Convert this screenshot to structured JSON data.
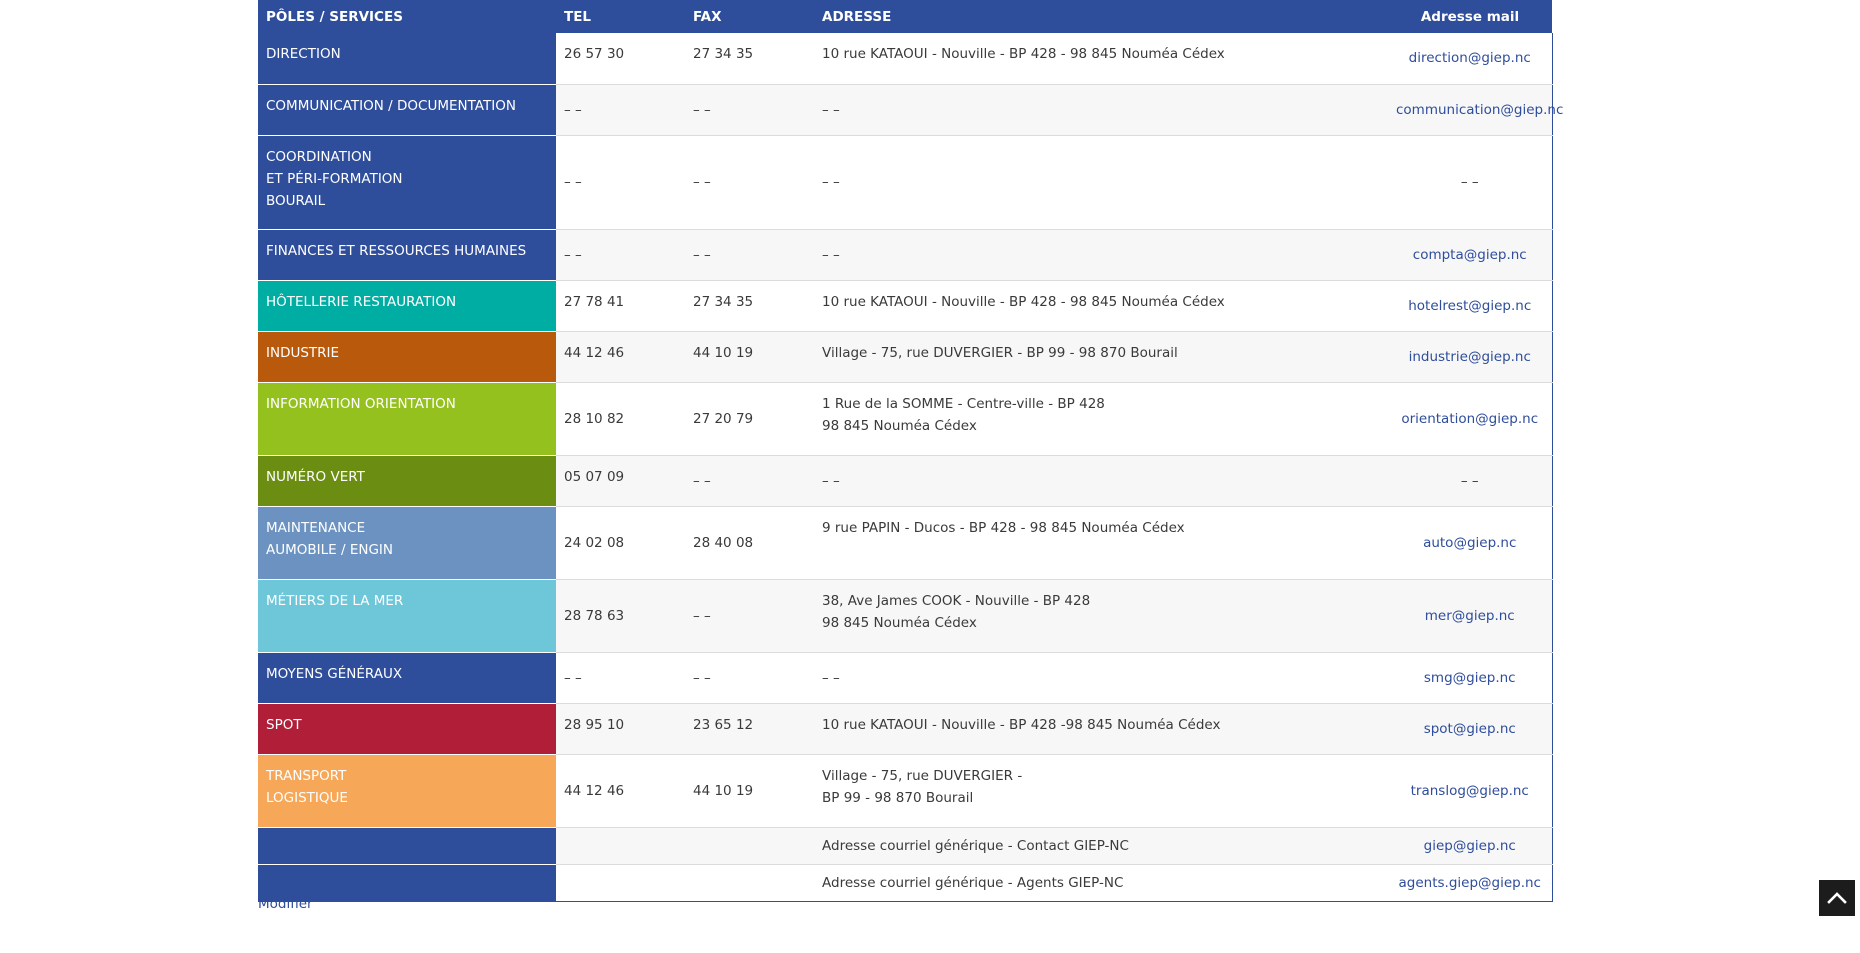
{
  "headers": {
    "pole": "PÔLES / SERVICES",
    "tel": "TEL",
    "fax": "FAX",
    "adresse": "ADRESSE",
    "mail": "Adresse mail"
  },
  "rows": [
    {
      "pole": [
        "DIRECTION"
      ],
      "color": "#2e4d9b",
      "tel": "26 57 30",
      "fax": "27 34 35",
      "adresse": [
        "10 rue KATAOUI - Nouville - BP 428 - 98 845 Nouméa Cédex"
      ],
      "mail": "direction@giep.nc",
      "h": 51
    },
    {
      "pole": [
        "COMMUNICATION / DOCUMENTATION"
      ],
      "color": "#2e4d9b",
      "tel": "– –",
      "fax": "– –",
      "adresse": [
        "– –"
      ],
      "mail": "communication@giep.nc",
      "h": 51,
      "mid": true
    },
    {
      "pole": [
        "COORDINATION",
        "ET PÉRI-FORMATION",
        "BOURAIL"
      ],
      "color": "#2e4d9b",
      "tel": "– –",
      "fax": "– –",
      "adresse": [
        "– –"
      ],
      "mail": "– –",
      "h": 94,
      "mid": true
    },
    {
      "pole": [
        "FINANCES ET RESSOURCES HUMAINES"
      ],
      "color": "#2e4d9b",
      "tel": "– –",
      "fax": "– –",
      "adresse": [
        "– –"
      ],
      "mail": "compta@giep.nc",
      "h": 51,
      "mid": true
    },
    {
      "pole": [
        "HÔTELLERIE RESTAURATION"
      ],
      "color": "#00ada2",
      "tel": "27 78 41",
      "fax": "27 34 35",
      "adresse": [
        "10 rue KATAOUI - Nouville - BP 428 - 98 845 Nouméa Cédex"
      ],
      "mail": "hotelrest@giep.nc",
      "h": 51
    },
    {
      "pole": [
        "INDUSTRIE"
      ],
      "color": "#b8590b",
      "tel": "44 12 46",
      "fax": "44 10 19",
      "adresse": [
        "Village - 75, rue DUVERGIER - BP 99 - 98 870 Bourail"
      ],
      "mail": "industrie@giep.nc",
      "h": 51
    },
    {
      "pole": [
        "INFORMATION ORIENTATION"
      ],
      "color": "#95c11f",
      "tel": "28 10 82",
      "fax": "27 20 79",
      "adresse": [
        "1 Rue de la SOMME - Centre-ville - BP 428",
        "98 845 Nouméa Cédex"
      ],
      "mail": "orientation@giep.nc",
      "h": 73,
      "telmid": true
    },
    {
      "pole": [
        "NUMÉRO VERT"
      ],
      "color": "#6b8e12",
      "tel": "05 07 09",
      "fax": "– –",
      "adresse": [
        "– –"
      ],
      "mail": "– –",
      "h": 51,
      "faxmid": true
    },
    {
      "pole": [
        "MAINTENANCE",
        "AUMOBILE / ENGIN"
      ],
      "color": "#6c92c2",
      "tel": "24 02 08",
      "fax": "28 40 08",
      "adresse": [
        "9 rue PAPIN - Ducos - BP 428 - 98 845 Nouméa Cédex"
      ],
      "mail": "auto@giep.nc",
      "h": 73,
      "telmid": true
    },
    {
      "pole": [
        "MÉTIERS DE LA MER"
      ],
      "color": "#6ec6d9",
      "tel": "28 78 63",
      "fax": "– –",
      "adresse": [
        "38, Ave James COOK - Nouville - BP 428",
        "98 845 Nouméa Cédex"
      ],
      "mail": "mer@giep.nc",
      "h": 73,
      "telmid": true,
      "faxmid": true
    },
    {
      "pole": [
        "MOYENS GÉNÉRAUX"
      ],
      "color": "#2e4d9b",
      "tel": "– –",
      "fax": "– –",
      "adresse": [
        "– –"
      ],
      "mail": "smg@giep.nc",
      "h": 51,
      "mid": true
    },
    {
      "pole": [
        "SPOT"
      ],
      "color": "#b01e38",
      "tel": "28 95 10",
      "fax": "23 65 12",
      "adresse": [
        "10 rue KATAOUI - Nouville - BP 428 -98 845 Nouméa Cédex"
      ],
      "mail": "spot@giep.nc",
      "h": 51
    },
    {
      "pole": [
        "TRANSPORT",
        "LOGISTIQUE"
      ],
      "color": "#f6a757",
      "tel": "44 12 46",
      "fax": "44 10 19",
      "adresse": [
        "Village - 75, rue DUVERGIER -",
        "BP 99 - 98 870 Bourail"
      ],
      "mail": "translog@giep.nc",
      "h": 73,
      "telmid": true
    },
    {
      "pole": [
        ""
      ],
      "color": "#2e4d9b",
      "tel": "",
      "fax": "",
      "adresse": [
        "Adresse courriel générique - Contact GIEP-NC"
      ],
      "mail": "giep@giep.nc",
      "h": 37,
      "mid": true
    },
    {
      "pole": [
        ""
      ],
      "color": "#2e4d9b",
      "tel": "",
      "fax": "",
      "adresse": [
        "Adresse courriel générique - Agents GIEP-NC"
      ],
      "mail": "agents.giep@giep.nc",
      "h": 37,
      "mid": true
    }
  ],
  "footer": {
    "modifier": "Modifier"
  },
  "icons": {
    "scroll_top": "chevron-up-icon"
  }
}
